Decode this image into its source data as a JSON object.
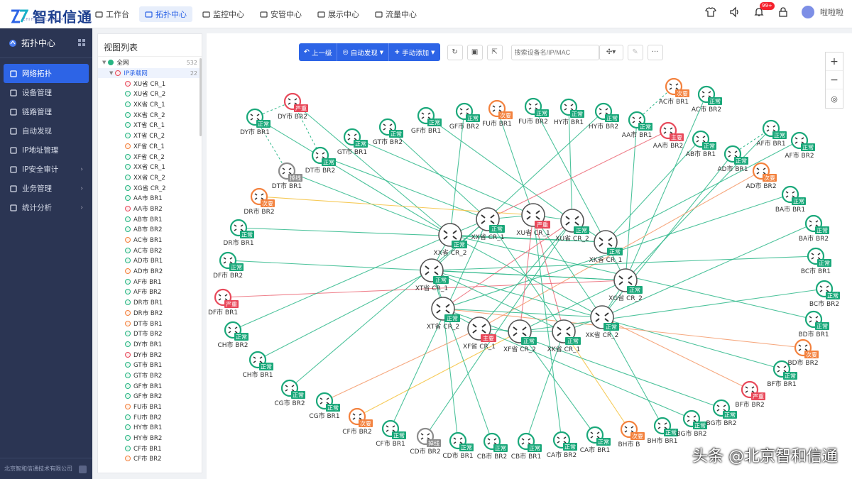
{
  "brand": {
    "name": "智和信通",
    "sub": "ZHIHE·TECH·COM"
  },
  "topnav": [
    {
      "label": "工作台",
      "icon": "home-icon",
      "active": false
    },
    {
      "label": "拓扑中心",
      "icon": "topology-icon",
      "active": true
    },
    {
      "label": "监控中心",
      "icon": "monitor-icon",
      "active": false
    },
    {
      "label": "安管中心",
      "icon": "shield-icon",
      "active": false
    },
    {
      "label": "展示中心",
      "icon": "display-icon",
      "active": false
    },
    {
      "label": "流量中心",
      "icon": "traffic-icon",
      "active": false
    }
  ],
  "header": {
    "badge": "99+",
    "user": "啦啦啦"
  },
  "sidebar": {
    "title": "拓扑中心",
    "items": [
      {
        "label": "网络拓扑",
        "active": true,
        "arrow": false
      },
      {
        "label": "设备管理",
        "active": false,
        "arrow": false
      },
      {
        "label": "链路管理",
        "active": false,
        "arrow": false
      },
      {
        "label": "自动发现",
        "active": false,
        "arrow": false
      },
      {
        "label": "IP地址管理",
        "active": false,
        "arrow": false
      },
      {
        "label": "IP安全审计",
        "active": false,
        "arrow": true
      },
      {
        "label": "业务管理",
        "active": false,
        "arrow": true
      },
      {
        "label": "统计分析",
        "active": false,
        "arrow": true
      }
    ],
    "footer": "北京智和信通技术有限公司"
  },
  "tree": {
    "title": "视图列表",
    "root": {
      "label": "全网",
      "count": "532"
    },
    "group": {
      "label": "IP承载网",
      "count": "22"
    },
    "items": [
      {
        "label": "XU省 CR_1",
        "s": "red"
      },
      {
        "label": "XU省 CR_2",
        "s": "green"
      },
      {
        "label": "XK省 CR_1",
        "s": "green"
      },
      {
        "label": "XK省 CR_2",
        "s": "green"
      },
      {
        "label": "XT省 CR_1",
        "s": "green"
      },
      {
        "label": "XT省 CR_2",
        "s": "green"
      },
      {
        "label": "XF省 CR_1",
        "s": "orange"
      },
      {
        "label": "XF省 CR_2",
        "s": "green"
      },
      {
        "label": "XX省 CR_1",
        "s": "green"
      },
      {
        "label": "XX省 CR_2",
        "s": "green"
      },
      {
        "label": "XG省 CR_2",
        "s": "green"
      },
      {
        "label": "AA市 BR1",
        "s": "green"
      },
      {
        "label": "AA市 BR2",
        "s": "red"
      },
      {
        "label": "AB市 BR1",
        "s": "green"
      },
      {
        "label": "AB市 BR2",
        "s": "green"
      },
      {
        "label": "AC市 BR1",
        "s": "orange"
      },
      {
        "label": "AC市 BR2",
        "s": "green"
      },
      {
        "label": "AD市 BR1",
        "s": "green"
      },
      {
        "label": "AD市 BR2",
        "s": "orange"
      },
      {
        "label": "AF市 BR1",
        "s": "green"
      },
      {
        "label": "AF市 BR2",
        "s": "green"
      },
      {
        "label": "DR市 BR1",
        "s": "green"
      },
      {
        "label": "DR市 BR2",
        "s": "orange"
      },
      {
        "label": "DT市 BR1",
        "s": "orange"
      },
      {
        "label": "DT市 BR2",
        "s": "green"
      },
      {
        "label": "DY市 BR1",
        "s": "green"
      },
      {
        "label": "DY市 BR2",
        "s": "red"
      },
      {
        "label": "GT市 BR1",
        "s": "green"
      },
      {
        "label": "GT市 BR2",
        "s": "green"
      },
      {
        "label": "GF市 BR1",
        "s": "green"
      },
      {
        "label": "GF市 BR2",
        "s": "green"
      },
      {
        "label": "FU市 BR1",
        "s": "orange"
      },
      {
        "label": "FU市 BR2",
        "s": "green"
      },
      {
        "label": "HY市 BR1",
        "s": "green"
      },
      {
        "label": "HY市 BR2",
        "s": "green"
      },
      {
        "label": "CF市 BR1",
        "s": "green"
      },
      {
        "label": "CF市 BR2",
        "s": "orange"
      }
    ]
  },
  "toolbar": {
    "up": "上一级",
    "auto": "自动发现",
    "add": "手动添加",
    "search_placeholder": "搜索设备名/IP/MAC"
  },
  "status_colors": {
    "正常": "#1aa87a",
    "严重": "#e8495a",
    "次要": "#f3813d",
    "主要": "#e8495a",
    "掉线": "#8c8c8c"
  },
  "routers": [
    {
      "id": "XXCR1",
      "label": "XX省 CR_1",
      "s": "正常"
    },
    {
      "id": "XUCR1",
      "label": "XU省 CR_1",
      "s": "严重"
    },
    {
      "id": "XUCR2",
      "label": "XU省 CR_2",
      "s": "正常"
    },
    {
      "id": "XXCR2",
      "label": "XX省 CR_2",
      "s": "正常"
    },
    {
      "id": "XKCR1",
      "label": "XK省 CR_1",
      "s": "正常"
    },
    {
      "id": "XTCR1",
      "label": "XT省 CR_1",
      "s": "正常"
    },
    {
      "id": "XGCR2",
      "label": "XG省 CR_2",
      "s": "正常"
    },
    {
      "id": "XTCR2",
      "label": "XT省 CR_2",
      "s": "正常"
    },
    {
      "id": "XKCR2",
      "label": "XK省 CR_2",
      "s": "正常"
    },
    {
      "id": "XFCR1",
      "label": "XF省 CR_1",
      "s": "主要"
    },
    {
      "id": "XFCR2",
      "label": "XF省 CR_2",
      "s": "正常"
    },
    {
      "id": "XKCR1b",
      "label": "XK省 CR_1",
      "s": "正常"
    }
  ],
  "nodes": [
    {
      "id": "DYBR1",
      "label": "DY市 BR1",
      "s": "正常"
    },
    {
      "id": "DYBR2",
      "label": "DY市 BR2",
      "s": "严重"
    },
    {
      "id": "DTBR2",
      "label": "DT市 BR2",
      "s": "正常"
    },
    {
      "id": "DTBR1",
      "label": "DT市 BR1",
      "s": "掉线"
    },
    {
      "id": "GTBR1",
      "label": "GT市 BR1",
      "s": "正常"
    },
    {
      "id": "GTBR2",
      "label": "GT市 BR2",
      "s": "正常"
    },
    {
      "id": "GFBR1",
      "label": "GF市 BR1",
      "s": "正常"
    },
    {
      "id": "GFBR2",
      "label": "GF市 BR2",
      "s": "正常"
    },
    {
      "id": "FUBR1",
      "label": "FU市 BR1",
      "s": "次要"
    },
    {
      "id": "FUBR2",
      "label": "FU市 BR2",
      "s": "正常"
    },
    {
      "id": "HYBR1",
      "label": "HY市 BR1",
      "s": "正常"
    },
    {
      "id": "HYBR2",
      "label": "HY市 BR2",
      "s": "正常"
    },
    {
      "id": "AABR1",
      "label": "AA市 BR1",
      "s": "正常"
    },
    {
      "id": "AABR2",
      "label": "AA市 BR2",
      "s": "主要"
    },
    {
      "id": "ACBR1",
      "label": "AC市 BR1",
      "s": "次要"
    },
    {
      "id": "ACBR2",
      "label": "AC市 BR2",
      "s": "正常"
    },
    {
      "id": "ABBR1",
      "label": "AB市 BR1",
      "s": "正常"
    },
    {
      "id": "ADBR1",
      "label": "AD市 BR1",
      "s": "正常"
    },
    {
      "id": "AFBR1",
      "label": "AF市 BR1",
      "s": "正常"
    },
    {
      "id": "AFBR2",
      "label": "AF市 BR2",
      "s": "正常"
    },
    {
      "id": "ADBR2",
      "label": "AD市 BR2",
      "s": "次要"
    },
    {
      "id": "DRBR2",
      "label": "DR市 BR2",
      "s": "次要"
    },
    {
      "id": "DRBR1",
      "label": "DR市 BR1",
      "s": "正常"
    },
    {
      "id": "DFBR2",
      "label": "DF市 BR2",
      "s": "正常"
    },
    {
      "id": "DFBR1",
      "label": "DF市 BR1",
      "s": "严重"
    },
    {
      "id": "CHBR2",
      "label": "CH市 BR2",
      "s": "正常"
    },
    {
      "id": "CHBR1",
      "label": "CH市 BR1",
      "s": "正常"
    },
    {
      "id": "CGBR2",
      "label": "CG市 BR2",
      "s": "正常"
    },
    {
      "id": "CGBR1",
      "label": "CG市 BR1",
      "s": "正常"
    },
    {
      "id": "CFBR2",
      "label": "CF市 BR2",
      "s": "次要"
    },
    {
      "id": "CFBR1",
      "label": "CF市 BR1",
      "s": "正常"
    },
    {
      "id": "CDBR2",
      "label": "CD市 BR2",
      "s": "掉线"
    },
    {
      "id": "CDBR1",
      "label": "CD市 BR1",
      "s": "正常"
    },
    {
      "id": "CBBR2",
      "label": "CB市 BR2",
      "s": "正常"
    },
    {
      "id": "CBBR1",
      "label": "CB市 BR1",
      "s": "正常"
    },
    {
      "id": "CABR2",
      "label": "CA市 BR2",
      "s": "正常"
    },
    {
      "id": "CABR1",
      "label": "CA市 BR1",
      "s": "正常"
    },
    {
      "id": "BHBR2",
      "label": "BH市 B",
      "s": "次要"
    },
    {
      "id": "BHBR1",
      "label": "BH市 BR1",
      "s": "正常"
    },
    {
      "id": "BGBR2",
      "label": "BG市 BR2",
      "s": "正常"
    },
    {
      "id": "BGBR2b",
      "label": "BG市 BR2",
      "s": "正常"
    },
    {
      "id": "BFBR2",
      "label": "BF市 BR2",
      "s": "严重"
    },
    {
      "id": "BFBR1",
      "label": "BF市 BR1",
      "s": "正常"
    },
    {
      "id": "BDBR2",
      "label": "BD市 BR2",
      "s": "次要"
    },
    {
      "id": "BDBR1",
      "label": "BD市 BR1",
      "s": "正常"
    },
    {
      "id": "BCBR2",
      "label": "BC市 BR2",
      "s": "正常"
    },
    {
      "id": "BCBR1",
      "label": "BC市 BR1",
      "s": "正常"
    },
    {
      "id": "BABR2",
      "label": "BA市 BR2",
      "s": "正常"
    },
    {
      "id": "BABR1",
      "label": "BA市 BR1",
      "s": "正常"
    }
  ],
  "links": [
    [
      "DYBR1",
      "XXCR2",
      "n"
    ],
    [
      "DYBR2",
      "XXCR2",
      "n"
    ],
    [
      "DTBR2",
      "XXCR1",
      "n"
    ],
    [
      "DTBR1",
      "XXCR2",
      "n"
    ],
    [
      "GTBR1",
      "XUCR1",
      "n"
    ],
    [
      "GTBR2",
      "XXCR1",
      "n"
    ],
    [
      "GFBR1",
      "XUCR2",
      "n"
    ],
    [
      "GFBR2",
      "XXCR2",
      "n"
    ],
    [
      "FUBR1",
      "XUCR1",
      "n"
    ],
    [
      "FUBR2",
      "XKCR1",
      "n"
    ],
    [
      "HYBR1",
      "XUCR2",
      "n"
    ],
    [
      "HYBR2",
      "XTCR1",
      "n"
    ],
    [
      "AABR1",
      "XGCR2",
      "n"
    ],
    [
      "AABR2",
      "XXCR1",
      "r"
    ],
    [
      "ACBR2",
      "XGCR2",
      "n"
    ],
    [
      "ABBR1",
      "XKCR1",
      "n"
    ],
    [
      "ADBR1",
      "XKCR2",
      "n"
    ],
    [
      "AFBR1",
      "XGCR2",
      "n"
    ],
    [
      "AFBR2",
      "XKCR1",
      "n"
    ],
    [
      "ADBR2",
      "XFCR1",
      "o"
    ],
    [
      "DRBR2",
      "XUCR1",
      "y"
    ],
    [
      "DRBR1",
      "XKCR1",
      "n"
    ],
    [
      "DFBR2",
      "XGCR2",
      "n"
    ],
    [
      "DFBR1",
      "XGCR2",
      "r"
    ],
    [
      "CHBR2",
      "XXCR2",
      "n"
    ],
    [
      "CHBR1",
      "XTCR1",
      "n"
    ],
    [
      "CGBR2",
      "XXCR1",
      "n"
    ],
    [
      "CGBR1",
      "XFCR1",
      "o"
    ],
    [
      "CFBR2",
      "XFCR2",
      "y"
    ],
    [
      "CFBR1",
      "XXCR1",
      "n"
    ],
    [
      "CDBR2",
      "XUCR2",
      "n"
    ],
    [
      "CDBR1",
      "XTCR2",
      "n"
    ],
    [
      "CBBR2",
      "XTCR1",
      "n"
    ],
    [
      "CBBR1",
      "XKCR1b",
      "n"
    ],
    [
      "CABR2",
      "XUCR1",
      "n"
    ],
    [
      "CABR1",
      "XFCR2",
      "n"
    ],
    [
      "BHBR2",
      "XKCR1b",
      "y"
    ],
    [
      "BHBR1",
      "XKCR2",
      "n"
    ],
    [
      "BGBR2",
      "XFCR1",
      "n"
    ],
    [
      "BGBR2b",
      "XTCR2",
      "n"
    ],
    [
      "BFBR2",
      "XKCR2",
      "o"
    ],
    [
      "BFBR1",
      "XTCR1",
      "n"
    ],
    [
      "BDBR2",
      "XTCR2",
      "o"
    ],
    [
      "BDBR1",
      "XXCR2",
      "n"
    ],
    [
      "BCBR2",
      "XFCR2",
      "n"
    ],
    [
      "BCBR1",
      "XTCR1",
      "n"
    ],
    [
      "BABR2",
      "XKCR2",
      "n"
    ],
    [
      "BABR1",
      "XTCR2",
      "n"
    ],
    [
      "XXCR1",
      "XUCR1",
      "n"
    ],
    [
      "XUCR1",
      "XUCR2",
      "n"
    ],
    [
      "XUCR2",
      "XKCR1",
      "n"
    ],
    [
      "XXCR2",
      "XTCR1",
      "n"
    ],
    [
      "XTCR1",
      "XTCR2",
      "n"
    ],
    [
      "XTCR2",
      "XFCR1",
      "n"
    ],
    [
      "XFCR1",
      "XFCR2",
      "n"
    ],
    [
      "XFCR2",
      "XKCR1b",
      "n"
    ],
    [
      "XKCR1b",
      "XKCR2",
      "n"
    ],
    [
      "XKCR2",
      "XGCR2",
      "n"
    ],
    [
      "XGCR2",
      "XKCR1",
      "n"
    ],
    [
      "XXCR2",
      "XXCR1",
      "n"
    ],
    [
      "XUCR1",
      "XFCR2",
      "r"
    ],
    [
      "XUCR1",
      "XKCR1b",
      "r"
    ],
    [
      "XTCR2",
      "XUCR2",
      "r"
    ],
    [
      "XXCR2",
      "XKCR1",
      "n"
    ],
    [
      "XTCR1",
      "XGCR2",
      "n"
    ],
    [
      "XTCR2",
      "XKCR2",
      "n"
    ],
    [
      "XXCR1",
      "XKCR1b",
      "n"
    ],
    [
      "XUCR2",
      "XFCR1",
      "n"
    ],
    [
      "XFCR2",
      "XGCR2",
      "n"
    ],
    [
      "XUCR1",
      "XKCR2",
      "n"
    ],
    [
      "XXCR2",
      "XKCR2",
      "n"
    ],
    [
      "XTCR1",
      "XKCR1b",
      "n"
    ]
  ],
  "dashed": [
    [
      "DYBR1",
      "DYBR2"
    ],
    [
      "DYBR2",
      "DTBR2"
    ],
    [
      "DYBR1",
      "DTBR1"
    ],
    [
      "AABR1",
      "ACBR1"
    ],
    [
      "ADBR1",
      "AFBR1"
    ]
  ],
  "watermark": "头条 @北京智和信通"
}
